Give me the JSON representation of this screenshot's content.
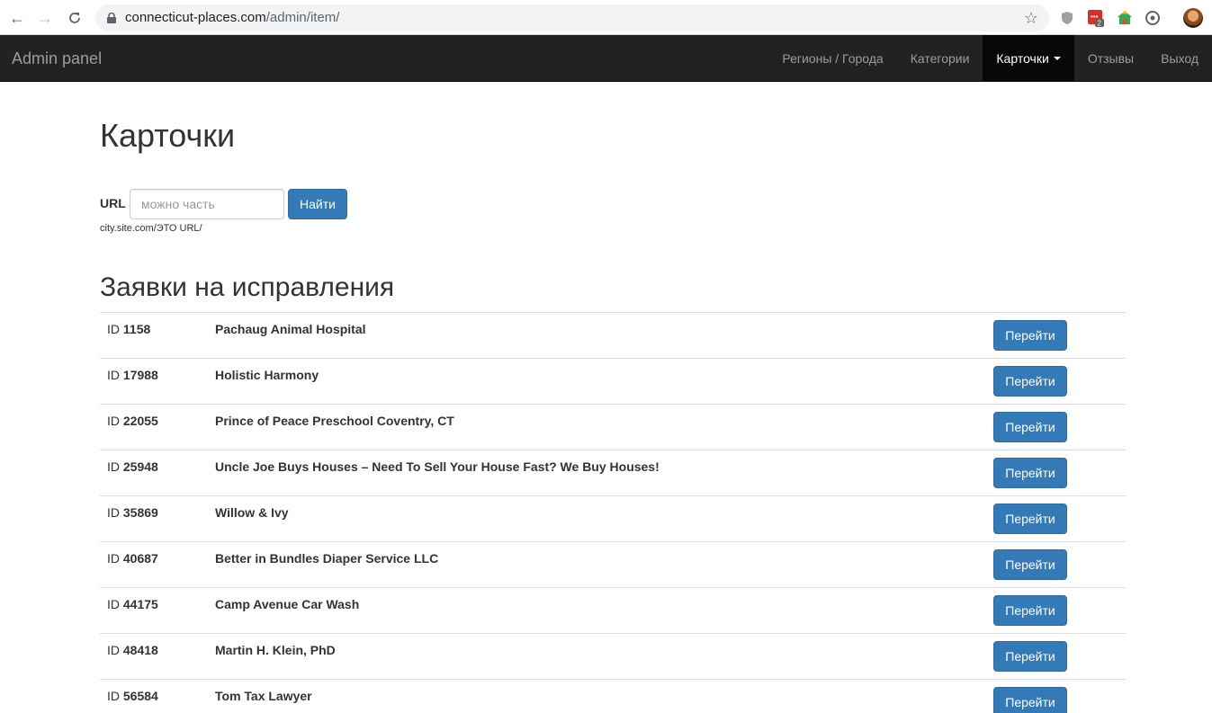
{
  "browser": {
    "url_host": "connecticut-places.com",
    "url_path": "/admin/item/",
    "ext_badge": "2"
  },
  "navbar": {
    "brand": "Admin panel",
    "items": [
      {
        "label": "Регионы / Города"
      },
      {
        "label": "Категории"
      },
      {
        "label": "Карточки",
        "active": true
      },
      {
        "label": "Отзывы"
      },
      {
        "label": "Выход"
      }
    ]
  },
  "page": {
    "title": "Карточки",
    "search_label": "URL",
    "search_placeholder": "можно часть",
    "search_button": "Найти",
    "help_text": "city.site.com/ЭТО URL/",
    "section_title": "Заявки на исправления"
  },
  "rows": [
    {
      "id_prefix": "ID",
      "id": "1158",
      "name": "Pachaug Animal Hospital",
      "action": "Перейти"
    },
    {
      "id_prefix": "ID",
      "id": "17988",
      "name": "Holistic Harmony",
      "action": "Перейти"
    },
    {
      "id_prefix": "ID",
      "id": "22055",
      "name": "Prince of Peace Preschool Coventry, CT",
      "action": "Перейти"
    },
    {
      "id_prefix": "ID",
      "id": "25948",
      "name": "Uncle Joe Buys Houses – Need To Sell Your House Fast? We Buy Houses!",
      "action": "Перейти"
    },
    {
      "id_prefix": "ID",
      "id": "35869",
      "name": "Willow & Ivy",
      "action": "Перейти"
    },
    {
      "id_prefix": "ID",
      "id": "40687",
      "name": "Better in Bundles Diaper Service LLC",
      "action": "Перейти"
    },
    {
      "id_prefix": "ID",
      "id": "44175",
      "name": "Camp Avenue Car Wash",
      "action": "Перейти"
    },
    {
      "id_prefix": "ID",
      "id": "48418",
      "name": "Martin H. Klein, PhD",
      "action": "Перейти"
    },
    {
      "id_prefix": "ID",
      "id": "56584",
      "name": "Tom Tax Lawyer",
      "action": "Перейти"
    }
  ]
}
